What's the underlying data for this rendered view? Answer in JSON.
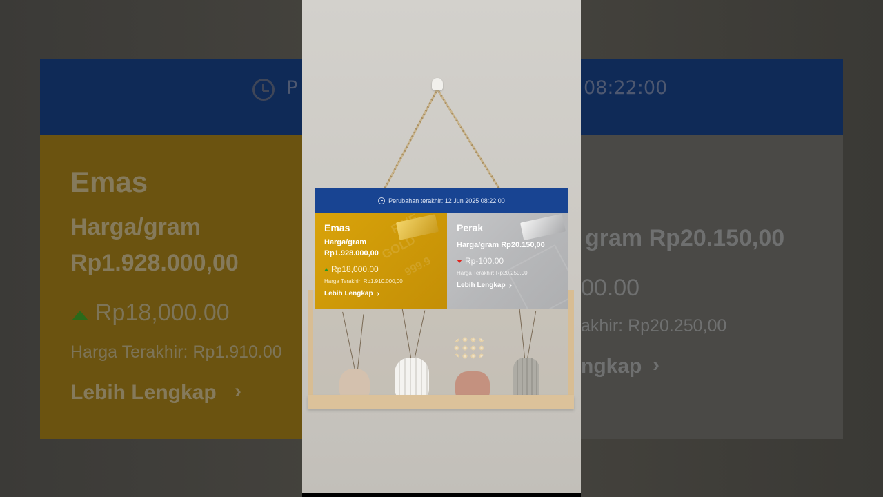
{
  "header": {
    "last_update": "Perubahan terakhir: 12 Jun 2025 08:22:00",
    "bg_prefix": "P",
    "bg_time": "08:22:00"
  },
  "gold": {
    "title": "Emas",
    "price_label": "Harga/gram",
    "price": "Rp1.928.000,00",
    "change": "Rp18,000.00",
    "change_direction": "up",
    "last_price": "Harga Terakhir: Rp1.910.000,00",
    "more": "Lebih Lengkap",
    "bg_last_price": "Harga Terakhir: Rp1.910.00",
    "watermark_fine": "FINE",
    "watermark_gold": "GOLD",
    "watermark_purity": "999.9"
  },
  "silver": {
    "title": "Perak",
    "price_line": "Harga/gram Rp20.150,00",
    "change": "Rp-100.00",
    "change_direction": "down",
    "last_price": "Harga Terakhir: Rp20.250,00",
    "more": "Lebih Lengkap",
    "bg_price_fragment": "gram Rp20.150,00",
    "bg_change_fragment": "00.00",
    "bg_last_fragment": "akhir: Rp20.250,00",
    "bg_more_fragment": "ngkap"
  },
  "colors": {
    "header_bg": "#184492",
    "gold_bg": "#d9a30b",
    "silver_bg": "#b7b8ba",
    "up": "#1c9a2a",
    "down": "#e0261e"
  },
  "icons": [
    "clock-icon",
    "triangle-up-icon",
    "triangle-down-icon",
    "chevron-right-icon"
  ]
}
